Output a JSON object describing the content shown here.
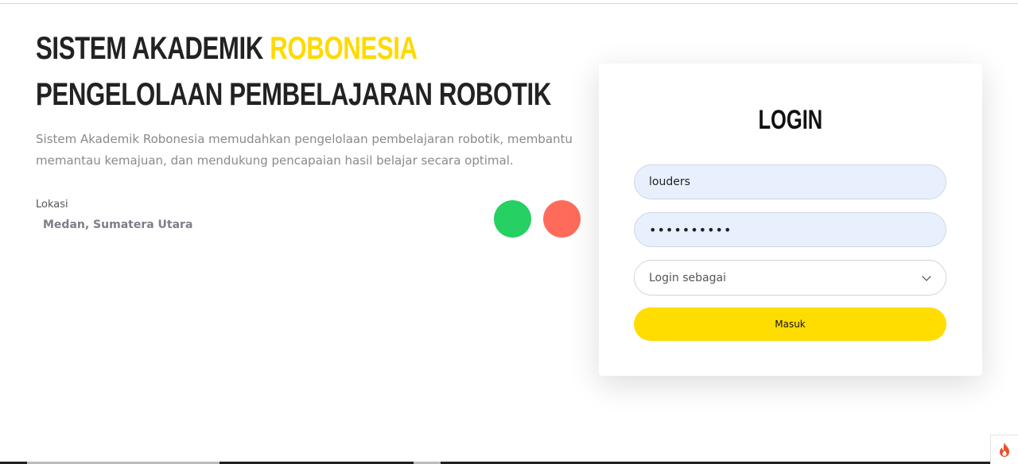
{
  "hero": {
    "title_prefix": "SISTEM AKADEMIK ",
    "title_accent": "ROBONESIA",
    "subtitle": "PENGELOLAAN PEMBELAJARAN ROBOTIK",
    "description": "Sistem Akademik Robonesia memudahkan pengelolaan pembelajaran robotik, membantu memantau kemajuan, dan mendukung pencapaian hasil belajar secara optimal.",
    "location_label": "Lokasi",
    "location_value": "Medan, Sumatera Utara"
  },
  "login": {
    "title": "LOGIN",
    "username_value": "louders",
    "password_value": "••••••••••",
    "role_select_value": "Login sebagai",
    "submit_label": "Masuk"
  },
  "colors": {
    "accent_yellow": "#ffd900",
    "button_yellow": "#ffdd00",
    "dot_green": "#26d063",
    "dot_red": "#ff6b5b",
    "input_bg": "#e8f0fe"
  },
  "icons": {
    "select_caret": "chevron-down-icon",
    "debug_toolbar": "flame-icon"
  }
}
